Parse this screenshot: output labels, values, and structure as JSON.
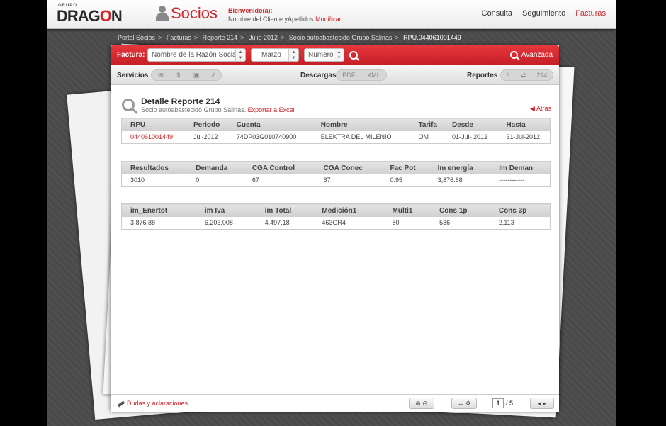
{
  "header": {
    "logo_small": "GRUPO",
    "logo_big_left": "DRAG",
    "logo_big_o": "O",
    "logo_big_right": "N",
    "section": "Socios",
    "welcome_title": "Bienvenido(a):",
    "welcome_name": "Nombre del Cliente yApellidos",
    "welcome_link": "Modificar",
    "nav": [
      {
        "label": "Consulta"
      },
      {
        "label": "Seguimiento"
      },
      {
        "label": "Facturas",
        "active": true
      }
    ]
  },
  "breadcrumb": [
    "Portal Socios",
    "Facturas",
    "Reporte 214",
    "Julio 2012",
    "Socio autoabastecido Grupo Salinas",
    "RPU.044061001449"
  ],
  "breadcrumb_sep": ">",
  "filterbar": {
    "label": "Factura:",
    "razon_social": "Nombre de la Razón Social",
    "mes": "Marzo",
    "numero": "Numero",
    "avanzada": "Avanzada"
  },
  "toolbar": {
    "servicios": "Servicios",
    "servicios_icons": [
      "mail-icon",
      "dollar-icon",
      "print-icon",
      "attach-icon"
    ],
    "dollar_glyph": "$",
    "descargas": "Descargas",
    "pdf": "PDF",
    "xml": "XML",
    "reportes": "Reportes",
    "reportes_num": "214"
  },
  "detail": {
    "title": "Detalle Reporte 214",
    "subtitle": "Socio autoabastecido Grupo Salinas.",
    "export_link": "Exportar a Excel",
    "back": "Atrás"
  },
  "table1": {
    "headers": [
      "RPU",
      "Periodo",
      "Cuenta",
      "Nombre",
      "Tarifa",
      "Desde",
      "Hasta"
    ],
    "row": [
      "044061001449",
      "Jul-2012",
      "74DP03G010740900",
      "ELEKTRA DEL MILENIO",
      "OM",
      "01-Jul- 2012",
      "31-Jul-2012"
    ]
  },
  "table2": {
    "headers": [
      "Resultados",
      "Demanda",
      "CGA Control",
      "CGA Conec",
      "Fac Pot",
      "Im energía",
      "Im Deman"
    ],
    "row": [
      "3010",
      "0",
      "67",
      "67",
      "0.95",
      "3,876.88",
      "------------"
    ]
  },
  "table3": {
    "headers": [
      "im_Enertot",
      "im Iva",
      "im Total",
      "Medición1",
      "Multi1",
      "Cons 1p",
      "Cons 3p"
    ],
    "row": [
      "3,876.88",
      "6,203,008",
      "4,497.18",
      "463GR4",
      "80",
      "536",
      "2,113"
    ]
  },
  "footer": {
    "dudas": "Dudas y aclaraciones",
    "page_current": "1",
    "page_total": "/ 5"
  },
  "colors": {
    "accent": "#d3232b"
  }
}
